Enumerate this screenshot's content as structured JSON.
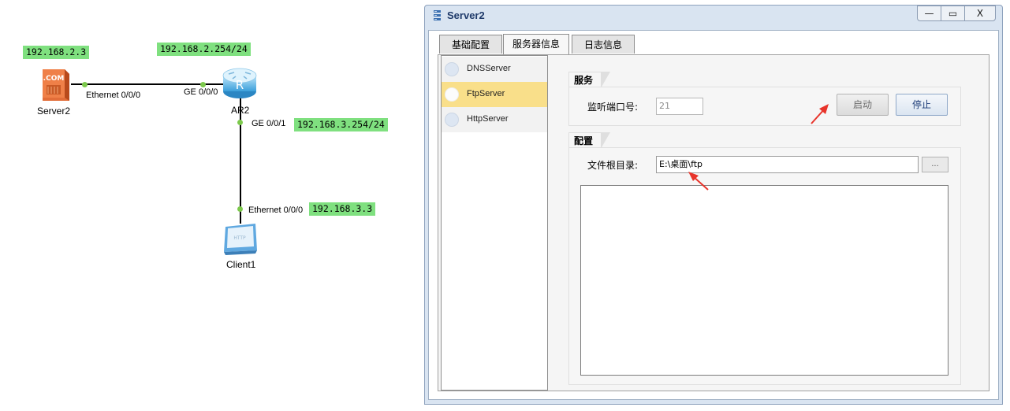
{
  "topology": {
    "ip_labels": {
      "server2_ip": "192.168.2.3",
      "ar2_ge000_ip": "192.168.2.254/24",
      "ar2_ge001_ip": "192.168.3.254/24",
      "client1_ip": "192.168.3.3"
    },
    "interfaces": {
      "server2_eth": "Ethernet 0/0/0",
      "ar2_ge000": "GE 0/0/0",
      "ar2_ge001": "GE 0/0/1",
      "client1_eth": "Ethernet 0/0/0"
    },
    "devices": {
      "server2": "Server2",
      "ar2": "AR2",
      "client1": "Client1"
    },
    "icons": {
      "server_text": ".COM",
      "router_text": "R",
      "client_text": "HTTP"
    }
  },
  "window": {
    "title": "Server2",
    "controls": {
      "minimize": "—",
      "maximize": "▭",
      "close": "X"
    },
    "tabs": [
      "基础配置",
      "服务器信息",
      "日志信息"
    ],
    "active_tab": "服务器信息",
    "services": [
      "DNSServer",
      "FtpServer",
      "HttpServer"
    ],
    "selected_service": "FtpServer",
    "service_group": {
      "title": "服务",
      "port_label": "监听端口号:",
      "port_value": "21",
      "start_button": "启动",
      "stop_button": "停止"
    },
    "config_group": {
      "title": "配置",
      "root_dir_label": "文件根目录:",
      "root_dir_value": "E:\\桌面\\ftp",
      "browse_button": "..."
    }
  },
  "colors": {
    "ip_label_bg": "#7fe07f",
    "port_dot": "#7cc94c",
    "selected_item": "#f9df8a",
    "annotation_arrow": "#e8342b",
    "title_text": "#1f3a6a"
  }
}
